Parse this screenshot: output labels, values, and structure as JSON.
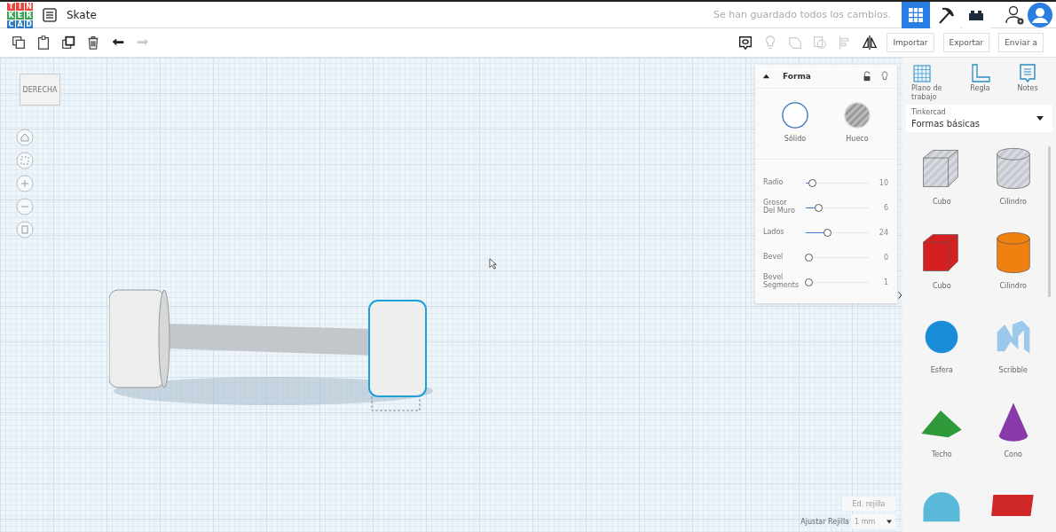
{
  "logo": {
    "rows": [
      {
        "letters": [
          "T",
          "I",
          "N"
        ]
      },
      {
        "letters": [
          "K",
          "E",
          "R"
        ]
      },
      {
        "letters": [
          "C",
          "A",
          "D"
        ]
      }
    ]
  },
  "title": "Skate",
  "save_status": "Se han guardado todos los cambios.",
  "view_buttons": [
    {
      "kind": "grid",
      "selected": true
    },
    {
      "kind": "pickaxe",
      "selected": false
    },
    {
      "kind": "bricks",
      "selected": false
    }
  ],
  "toolbar": {
    "actions": [
      "Importar",
      "Exportar",
      "Enviar a"
    ]
  },
  "view_cube": {
    "label": "DERECHA"
  },
  "shape_panel": {
    "title": "Forma",
    "expanded": true,
    "options": [
      {
        "label": "Sólido",
        "selected": true
      },
      {
        "label": "Hueco",
        "selected": false
      }
    ],
    "sliders": [
      {
        "label": "Radio",
        "level": 0.05,
        "reading": "10"
      },
      {
        "label": "Grosor Del Muro",
        "level": 0.15,
        "reading": "6"
      },
      {
        "label": "Lados",
        "level": 0.3,
        "reading": "24"
      },
      {
        "label": "Bevel",
        "level": 0,
        "reading": "0"
      },
      {
        "label": "Bevel Segments",
        "level": 0,
        "reading": "1"
      }
    ]
  },
  "grid_controls": {
    "edit_button": "Ed. rejilla",
    "snap_label": "Ajustar Rejilla",
    "snap_value": "1 mm"
  },
  "sidebar": {
    "tools": [
      {
        "kind": "workplane",
        "label": "Plano de trabajo"
      },
      {
        "kind": "ruler",
        "label": "Regla"
      },
      {
        "kind": "notes",
        "label": "Notes"
      }
    ],
    "library_caption": "Tinkercad",
    "library": "Formas básicas",
    "shapes": [
      {
        "kind": "box",
        "label": "Cubo",
        "color": "#c4c8d0"
      },
      {
        "kind": "cylinder",
        "label": "Cilindro",
        "color": "#c4c8d0"
      },
      {
        "kind": "box",
        "label": "Cubo",
        "color": "#d42020"
      },
      {
        "kind": "cylinder",
        "label": "Cilindro",
        "color": "#f08010"
      },
      {
        "kind": "sphere",
        "label": "Esfera",
        "color": "#1a8cd8"
      },
      {
        "kind": "scribble",
        "label": "Scribble",
        "color": "#9cc8ec"
      },
      {
        "kind": "roof",
        "label": "Techo",
        "color": "#2e9a3a"
      },
      {
        "kind": "cone",
        "label": "Cono",
        "color": "#8a3aa8"
      },
      {
        "kind": "halfcylinder",
        "color": "#5ab8d8"
      },
      {
        "kind": "text3d",
        "color": "#d02828"
      }
    ]
  }
}
